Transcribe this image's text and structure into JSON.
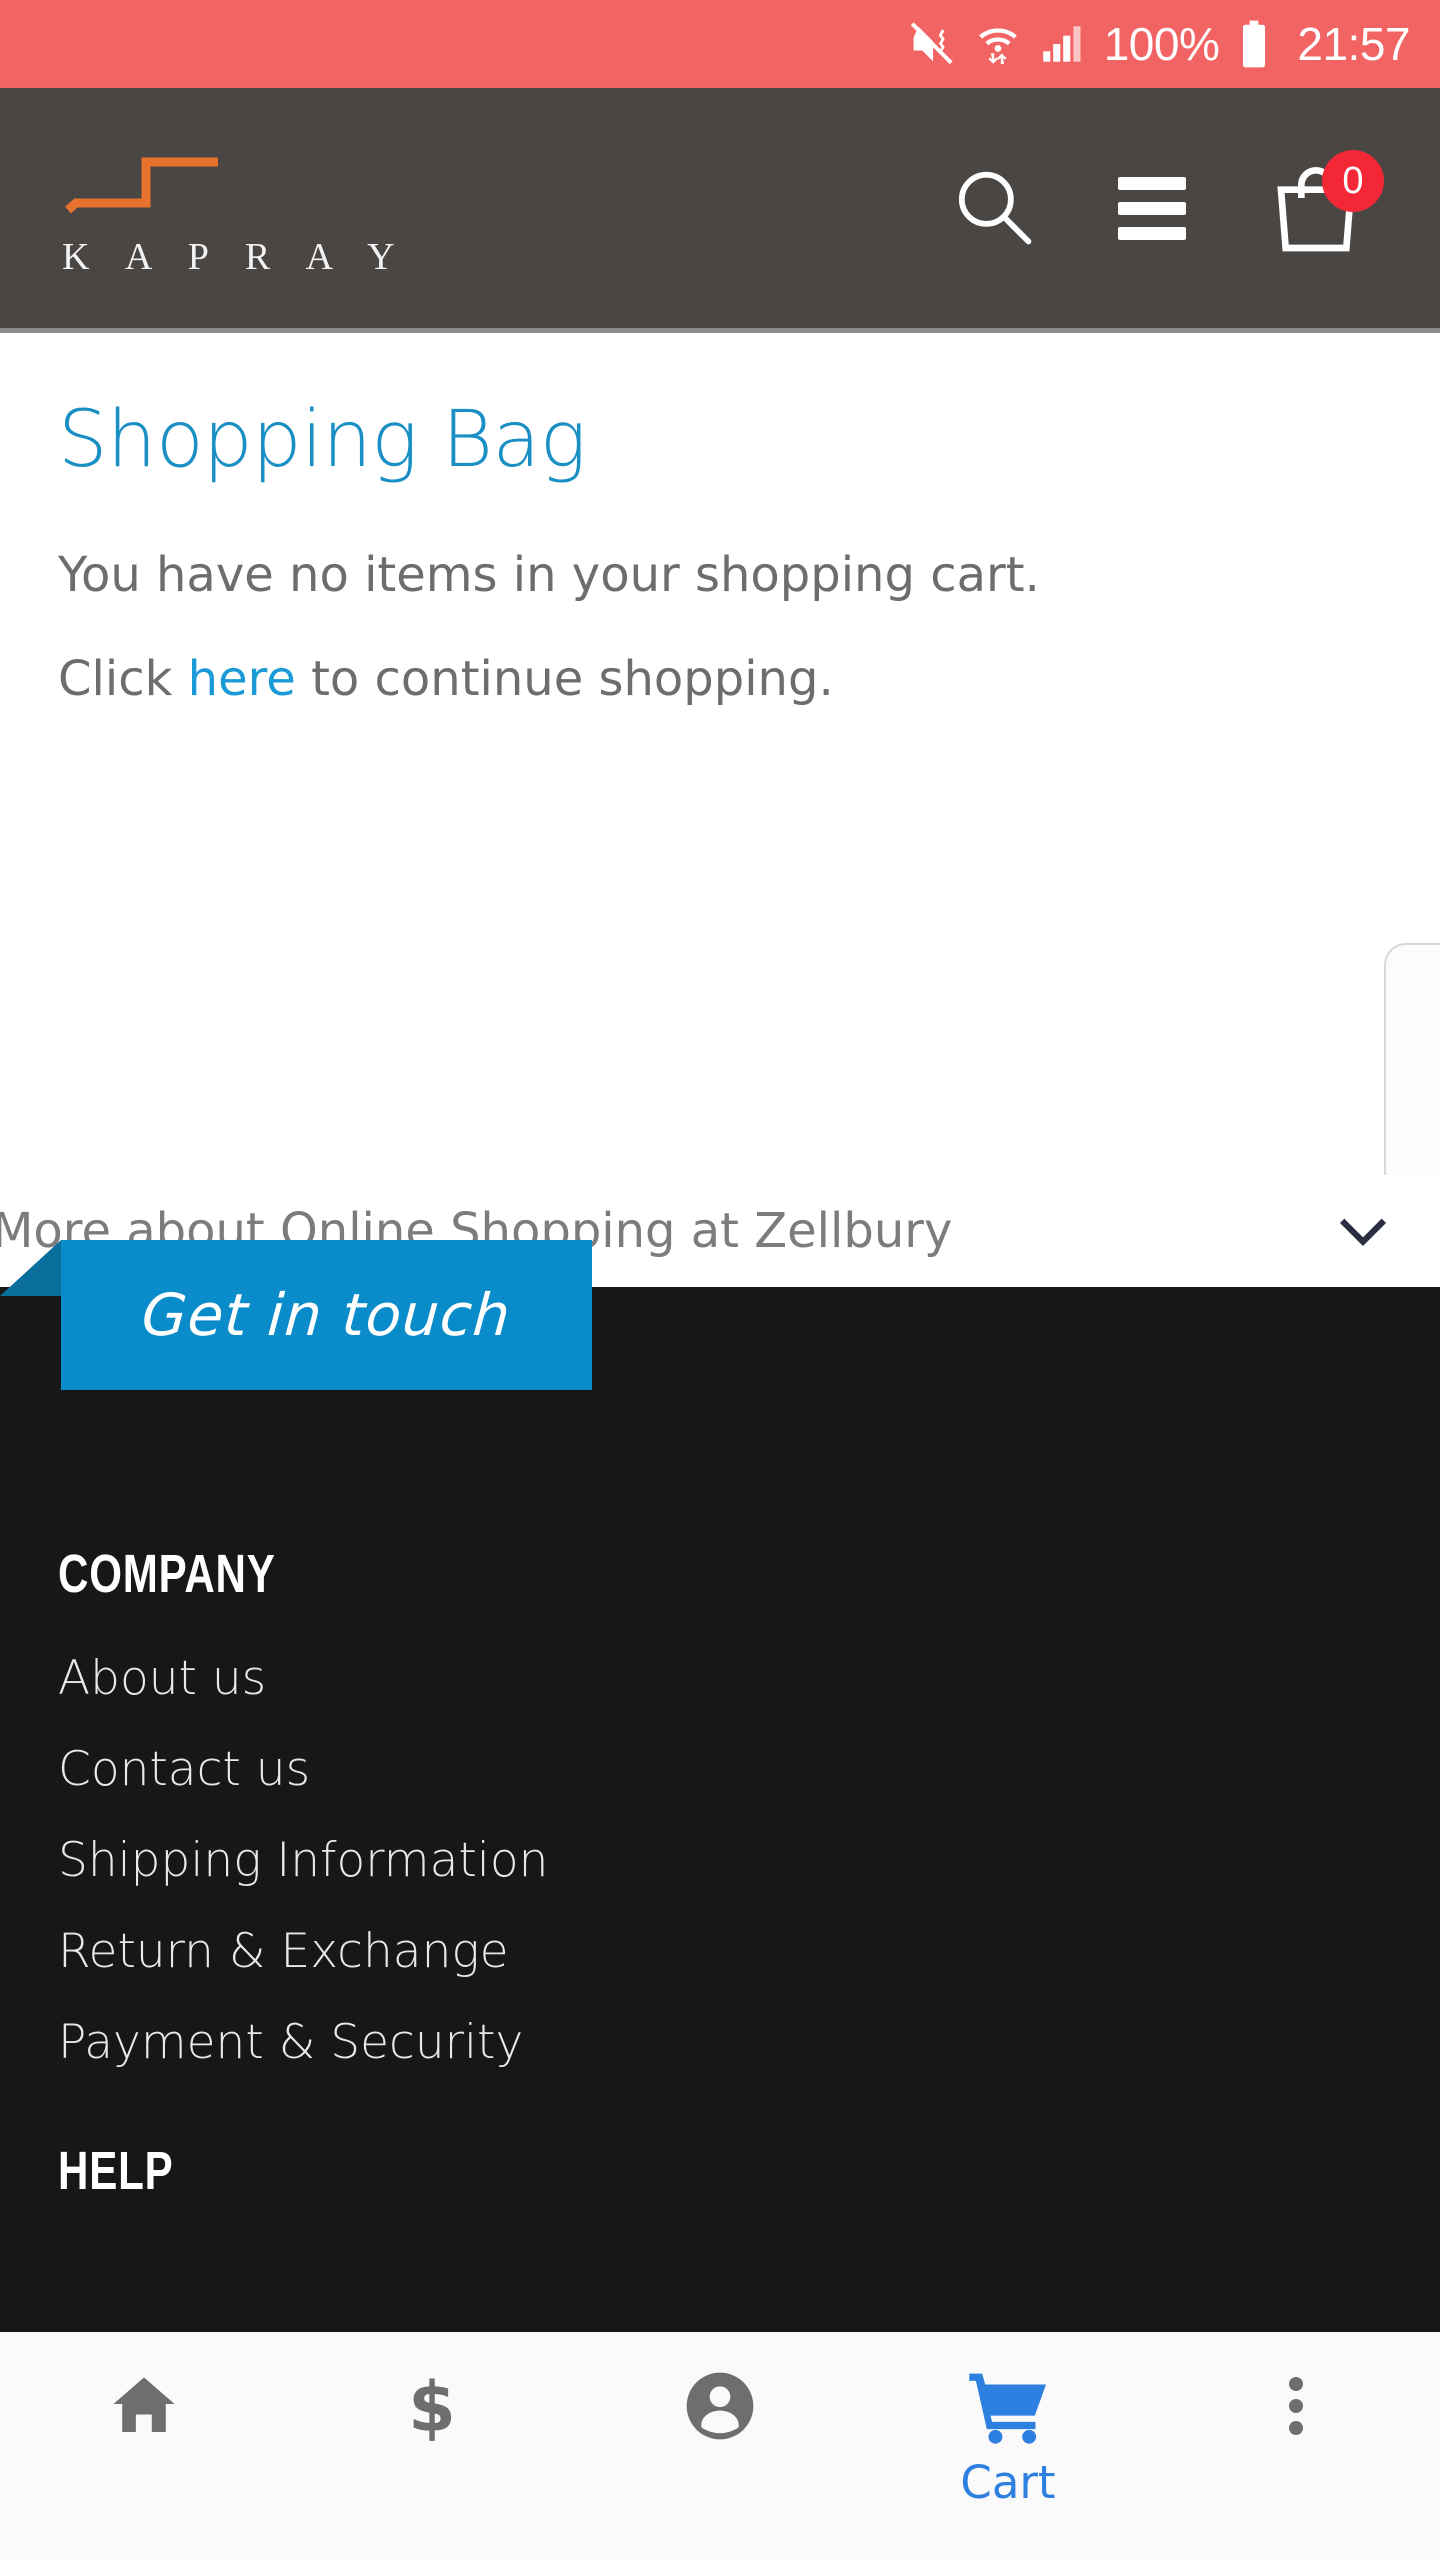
{
  "status_bar": {
    "icons": [
      "mute-vibrate-icon",
      "wifi-icon",
      "signal-icon",
      "battery-icon"
    ],
    "battery_percent": "100%",
    "time": "21:57",
    "background_color": "#f26464"
  },
  "header": {
    "brand_name": "K A P R A Y",
    "brand_mark": "kapray-step-logo",
    "background_color": "#4a4644",
    "accent_color": "#e8722d",
    "actions": {
      "search_icon": "search-icon",
      "menu_icon": "hamburger-menu-icon",
      "bag_icon": "shopping-bag-icon",
      "bag_count": "0",
      "badge_color": "#f32735"
    }
  },
  "main": {
    "title": "Shopping Bag",
    "title_color": "#1a8fc4",
    "empty_message": "You have no items in your shopping cart.",
    "continue_prefix": "Click ",
    "continue_link": "here",
    "continue_suffix": " to continue shopping.",
    "link_color": "#1a9ad6"
  },
  "accordion": {
    "label": "More about Online Shopping at Zellbury",
    "chevron_icon": "chevron-down-icon"
  },
  "get_in_touch": {
    "label": "Get in touch",
    "background_color": "#0b8cca"
  },
  "footer": {
    "background_color": "#161719",
    "sections": [
      {
        "heading": "COMPANY",
        "links": [
          "About us",
          "Contact us",
          "Shipping Information",
          "Return & Exchange",
          "Payment & Security"
        ]
      },
      {
        "heading": "HELP",
        "links": []
      }
    ]
  },
  "bottom_nav": {
    "active_color": "#2d7fe0",
    "inactive_color": "#6e6e6e",
    "items": [
      {
        "icon": "home-icon",
        "label": ""
      },
      {
        "icon": "dollar-icon",
        "label": ""
      },
      {
        "icon": "account-person-icon",
        "label": ""
      },
      {
        "icon": "shopping-cart-icon",
        "label": "Cart"
      },
      {
        "icon": "more-vertical-icon",
        "label": ""
      }
    ]
  }
}
